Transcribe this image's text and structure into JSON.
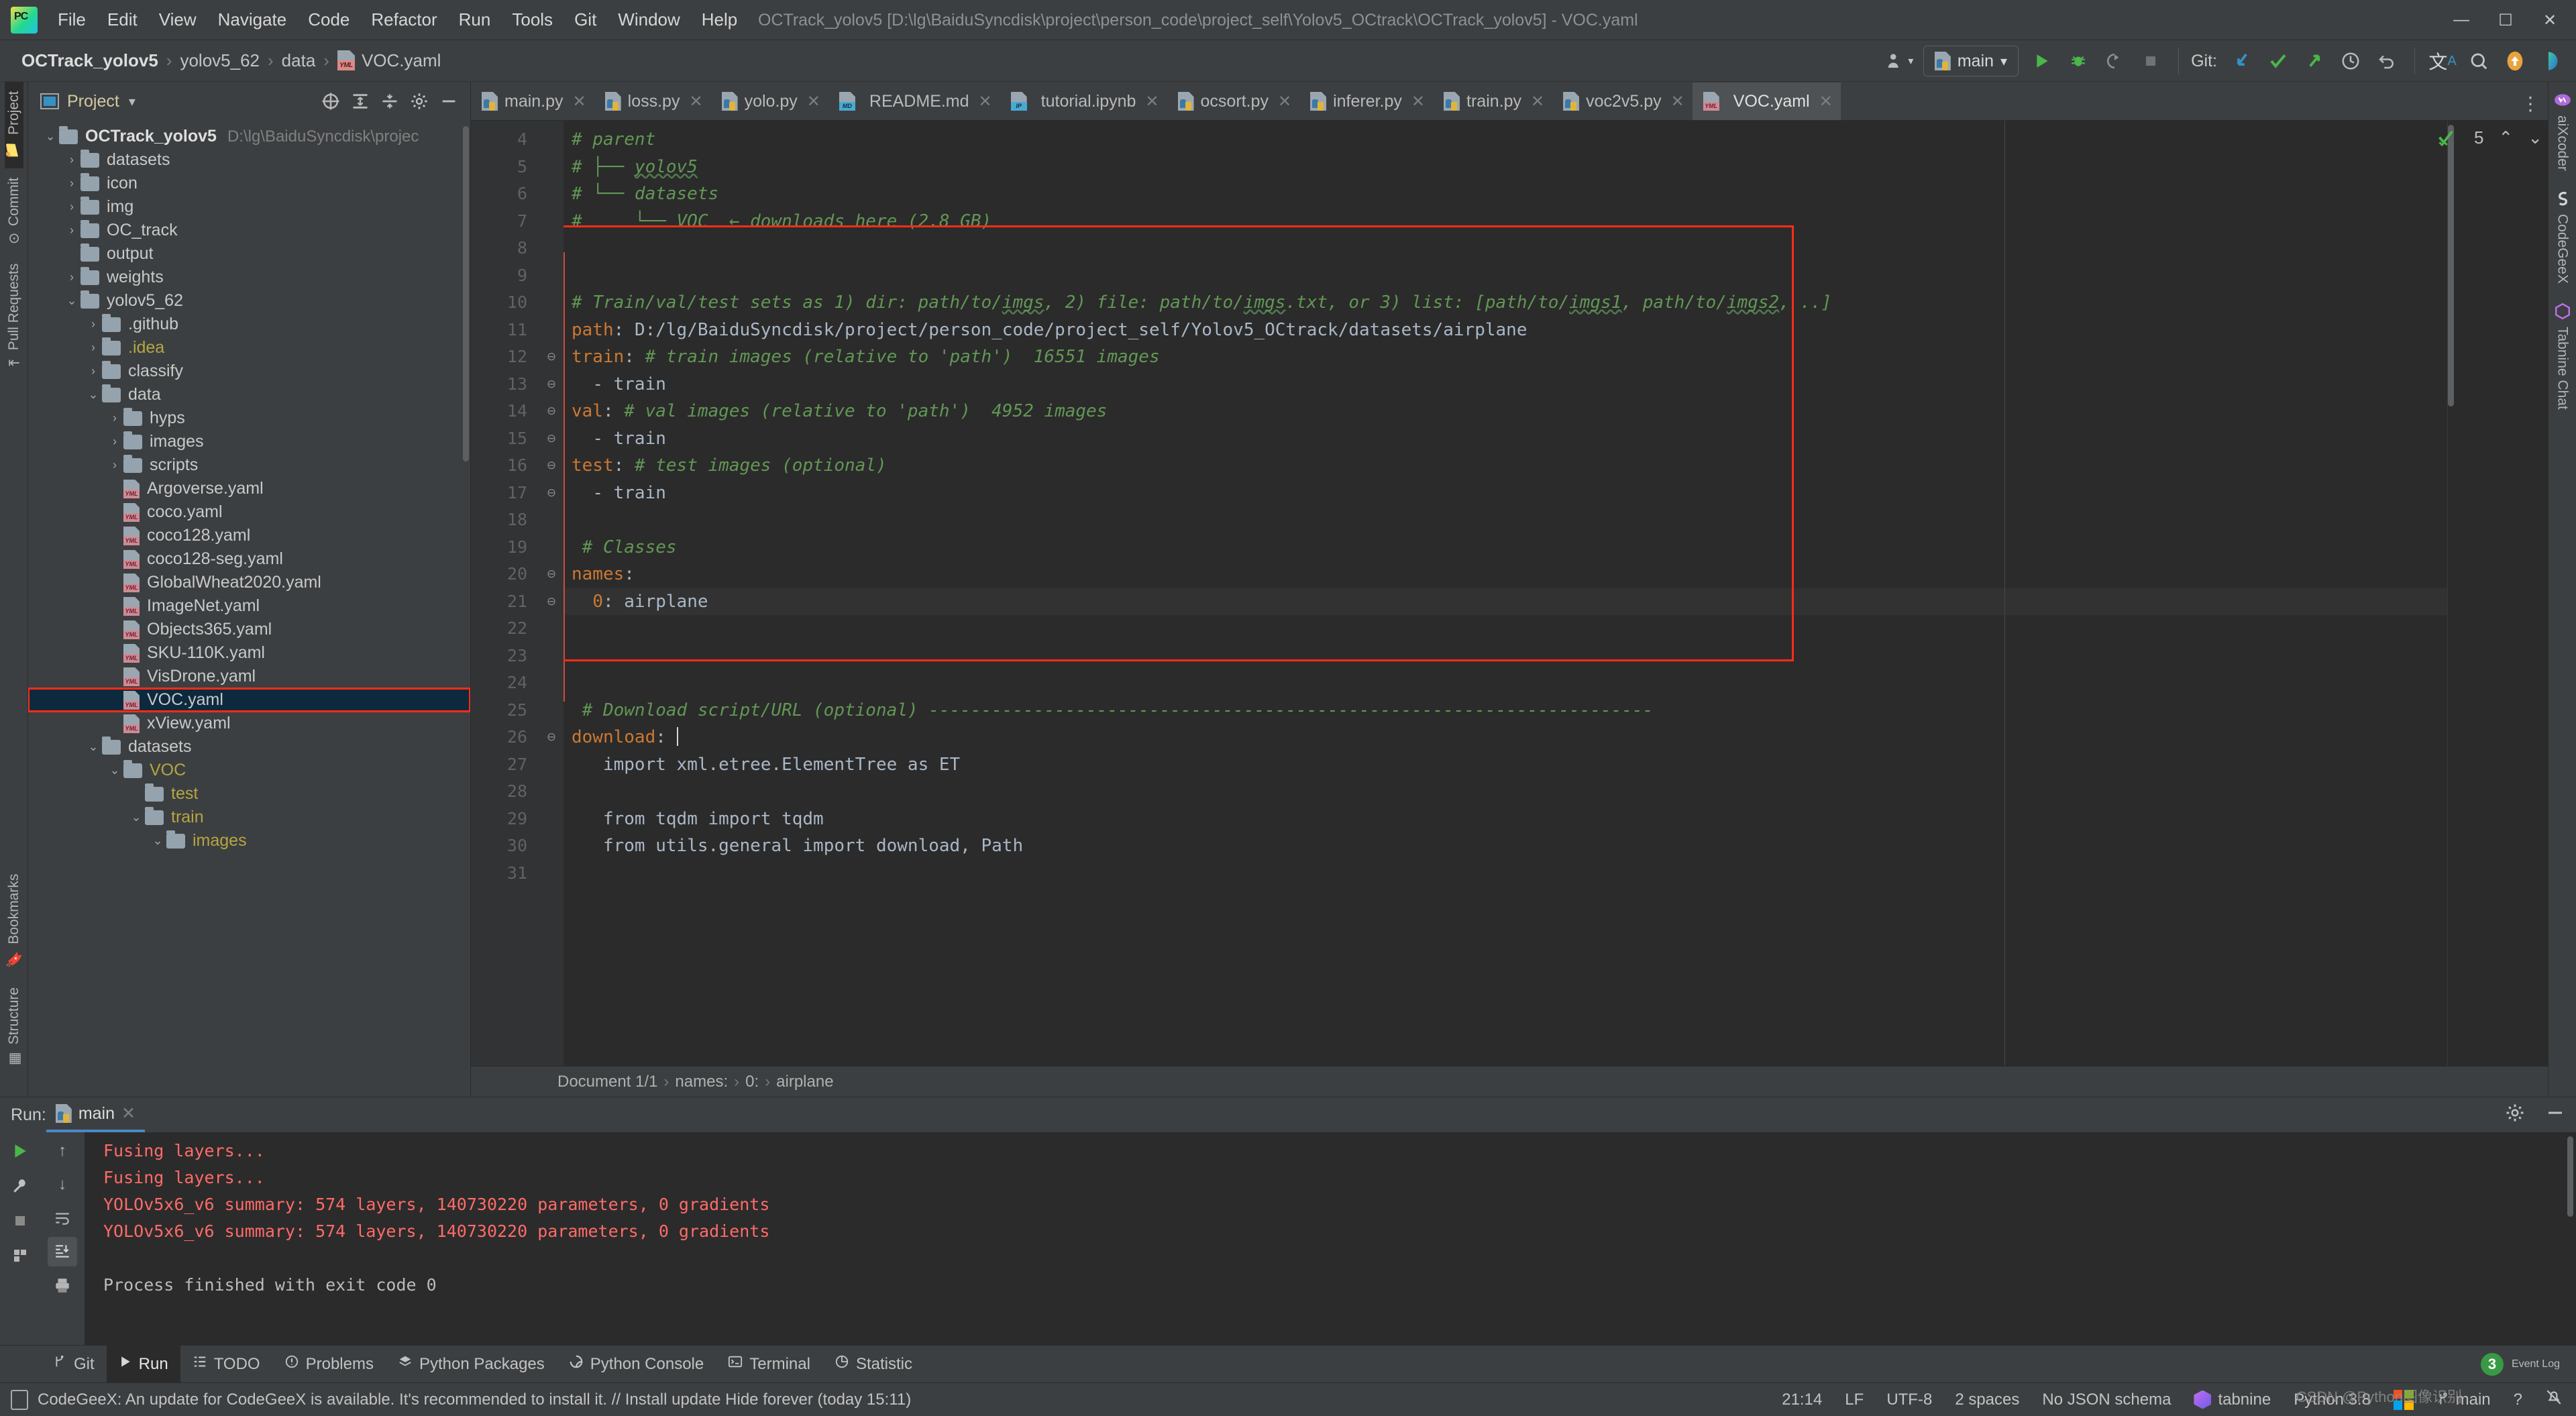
{
  "window": {
    "title": "OCTrack_yolov5 [D:\\lg\\BaiduSyncdisk\\project\\person_code\\project_self\\Yolov5_OCtrack\\OCTrack_yolov5] - VOC.yaml",
    "minimize": "—",
    "maximize": "☐",
    "close": "✕"
  },
  "menu": {
    "items": [
      "File",
      "Edit",
      "View",
      "Navigate",
      "Code",
      "Refactor",
      "Run",
      "Tools",
      "Git",
      "Window",
      "Help"
    ]
  },
  "breadcrumbs": {
    "items": [
      "OCTrack_yolov5",
      "yolov5_62",
      "data",
      "VOC.yaml"
    ],
    "separator": "›"
  },
  "toolbar": {
    "run_config": "main",
    "git_label": "Git:",
    "dropdown_caret": "▾"
  },
  "left_stripe": {
    "tabs": [
      "Project",
      "Commit",
      "Pull Requests"
    ],
    "bottom_tabs": [
      "Structure",
      "Bookmarks"
    ]
  },
  "right_stripe": {
    "tabs": [
      "aiXcoder",
      "CodeGeeX",
      "Tabnine Chat"
    ]
  },
  "project_panel": {
    "title": "Project",
    "caret": "▾",
    "tree": [
      {
        "depth": 0,
        "arrow": "⌄",
        "type": "folder",
        "label": "OCTrack_yolov5",
        "bold": true,
        "path": "D:\\lg\\BaiduSyncdisk\\projec"
      },
      {
        "depth": 1,
        "arrow": "›",
        "type": "folder",
        "label": "datasets"
      },
      {
        "depth": 1,
        "arrow": "›",
        "type": "folder",
        "label": "icon"
      },
      {
        "depth": 1,
        "arrow": "›",
        "type": "folder",
        "label": "img"
      },
      {
        "depth": 1,
        "arrow": "›",
        "type": "folder",
        "label": "OC_track"
      },
      {
        "depth": 1,
        "arrow": "",
        "type": "folder",
        "label": "output"
      },
      {
        "depth": 1,
        "arrow": "›",
        "type": "folder",
        "label": "weights"
      },
      {
        "depth": 1,
        "arrow": "⌄",
        "type": "folder",
        "label": "yolov5_62"
      },
      {
        "depth": 2,
        "arrow": "›",
        "type": "folder",
        "label": ".github"
      },
      {
        "depth": 2,
        "arrow": "›",
        "type": "folder",
        "label": ".idea",
        "color": "yellow"
      },
      {
        "depth": 2,
        "arrow": "›",
        "type": "folder",
        "label": "classify"
      },
      {
        "depth": 2,
        "arrow": "⌄",
        "type": "folder",
        "label": "data"
      },
      {
        "depth": 3,
        "arrow": "›",
        "type": "folder",
        "label": "hyps"
      },
      {
        "depth": 3,
        "arrow": "›",
        "type": "folder",
        "label": "images"
      },
      {
        "depth": 3,
        "arrow": "›",
        "type": "folder",
        "label": "scripts"
      },
      {
        "depth": 3,
        "arrow": "",
        "type": "yaml",
        "label": "Argoverse.yaml"
      },
      {
        "depth": 3,
        "arrow": "",
        "type": "yaml",
        "label": "coco.yaml"
      },
      {
        "depth": 3,
        "arrow": "",
        "type": "yaml",
        "label": "coco128.yaml"
      },
      {
        "depth": 3,
        "arrow": "",
        "type": "yaml",
        "label": "coco128-seg.yaml"
      },
      {
        "depth": 3,
        "arrow": "",
        "type": "yaml",
        "label": "GlobalWheat2020.yaml"
      },
      {
        "depth": 3,
        "arrow": "",
        "type": "yaml",
        "label": "ImageNet.yaml"
      },
      {
        "depth": 3,
        "arrow": "",
        "type": "yaml",
        "label": "Objects365.yaml"
      },
      {
        "depth": 3,
        "arrow": "",
        "type": "yaml",
        "label": "SKU-110K.yaml"
      },
      {
        "depth": 3,
        "arrow": "",
        "type": "yaml",
        "label": "VisDrone.yaml"
      },
      {
        "depth": 3,
        "arrow": "",
        "type": "yaml",
        "label": "VOC.yaml",
        "selected": true,
        "boxed": true
      },
      {
        "depth": 3,
        "arrow": "",
        "type": "yaml",
        "label": "xView.yaml"
      },
      {
        "depth": 2,
        "arrow": "⌄",
        "type": "folder",
        "label": "datasets"
      },
      {
        "depth": 3,
        "arrow": "⌄",
        "type": "folder",
        "label": "VOC",
        "color": "yellow"
      },
      {
        "depth": 4,
        "arrow": "",
        "type": "folder",
        "label": "test",
        "color": "yellow"
      },
      {
        "depth": 4,
        "arrow": "⌄",
        "type": "folder",
        "label": "train",
        "color": "yellow"
      },
      {
        "depth": 5,
        "arrow": "⌄",
        "type": "folder",
        "label": "images",
        "color": "yellow"
      }
    ]
  },
  "editor": {
    "tabs": [
      {
        "label": "main.py",
        "icon": "python-file-icon",
        "active": false
      },
      {
        "label": "loss.py",
        "icon": "python-file-icon",
        "active": false
      },
      {
        "label": "yolo.py",
        "icon": "python-file-icon",
        "active": false
      },
      {
        "label": "README.md",
        "icon": "markdown-file-icon",
        "active": false
      },
      {
        "label": "tutorial.ipynb",
        "icon": "notebook-file-icon",
        "active": false
      },
      {
        "label": "ocsort.py",
        "icon": "python-file-icon",
        "active": false
      },
      {
        "label": "inferer.py",
        "icon": "python-file-icon",
        "active": false
      },
      {
        "label": "train.py",
        "icon": "python-file-icon",
        "active": false
      },
      {
        "label": "voc2v5.py",
        "icon": "python-file-icon",
        "active": false
      },
      {
        "label": "VOC.yaml",
        "icon": "yaml-file-icon",
        "active": true
      }
    ],
    "tab_close": "✕",
    "inspection_count": "5",
    "inspection_up": "⌃",
    "inspection_down": "⌄",
    "first_line_number": 4,
    "lines": [
      {
        "n": 4,
        "fold": "",
        "html": "<span class=\"cm\"># parent</span>"
      },
      {
        "n": 5,
        "fold": "",
        "html": "<span class=\"cm\"># ├── <span class=\"squig\">yolov5</span></span>"
      },
      {
        "n": 6,
        "fold": "",
        "html": "<span class=\"cm\"># └── datasets</span>"
      },
      {
        "n": 7,
        "fold": "",
        "html": "<span class=\"cm\">#     └── VOC  ← downloads here (2.8 GB)</span>"
      },
      {
        "n": 8,
        "fold": "",
        "html": ""
      },
      {
        "n": 9,
        "fold": "",
        "html": ""
      },
      {
        "n": 10,
        "fold": "",
        "html": "<span class=\"cm\"># Train/val/test sets as 1) dir: path/to/<span class=\"squig\">imgs</span>, 2) file: path/to/<span class=\"squig\">imgs</span>.txt, or 3) list: [path/to/<span class=\"squig\">imgs1</span>, path/to/<span class=\"squig\">imgs2</span>, ..]</span>"
      },
      {
        "n": 11,
        "fold": "",
        "html": "<span class=\"key\">path</span>: <span class=\"val\">D:/lg/BaiduSyncdisk/project/person_code/project_self/Yolov5_OCtrack/datasets/airplane</span>"
      },
      {
        "n": 12,
        "fold": "⊖",
        "html": "<span class=\"key\">train</span>: <span class=\"cm\"># train images (relative to 'path')  16551 images</span>"
      },
      {
        "n": 13,
        "fold": "⊖",
        "html": "  <span class=\"val\">- train</span>"
      },
      {
        "n": 14,
        "fold": "⊖",
        "html": "<span class=\"key\">val</span>: <span class=\"cm\"># val images (relative to 'path')  4952 images</span>"
      },
      {
        "n": 15,
        "fold": "⊖",
        "html": "  <span class=\"val\">- train</span>"
      },
      {
        "n": 16,
        "fold": "⊖",
        "html": "<span class=\"key\">test</span>: <span class=\"cm\"># test images (optional)</span>"
      },
      {
        "n": 17,
        "fold": "⊖",
        "html": "  <span class=\"val\">- train</span>"
      },
      {
        "n": 18,
        "fold": "",
        "html": ""
      },
      {
        "n": 19,
        "fold": "",
        "html": " <span class=\"cm\"># Classes</span>"
      },
      {
        "n": 20,
        "fold": "⊖",
        "html": "<span class=\"key\">names</span>:"
      },
      {
        "n": 21,
        "fold": "⊖",
        "html": "  <span class=\"key\">0</span>: <span class=\"val\">airplane</span>",
        "highlight": true
      },
      {
        "n": 22,
        "fold": "",
        "html": ""
      },
      {
        "n": 23,
        "fold": "",
        "html": ""
      },
      {
        "n": 24,
        "fold": "",
        "html": ""
      },
      {
        "n": 25,
        "fold": "",
        "html": " <span class=\"cm\"># Download script/URL (optional) ---------------------------------------------------------------------</span>"
      },
      {
        "n": 26,
        "fold": "⊖",
        "html": "<span class=\"key\">download</span>: <span class=\"caret\"></span>"
      },
      {
        "n": 27,
        "fold": "",
        "html": "   <span class=\"val\">import xml.etree.ElementTree as ET</span>"
      },
      {
        "n": 28,
        "fold": "",
        "html": ""
      },
      {
        "n": 29,
        "fold": "",
        "html": "   <span class=\"val\">from tqdm import tqdm</span>"
      },
      {
        "n": 30,
        "fold": "",
        "html": "   <span class=\"val\">from utils.general import download, Path</span>"
      },
      {
        "n": 31,
        "fold": "",
        "html": ""
      }
    ],
    "status_breadcrumb": [
      "Document 1/1",
      "names:",
      "0:",
      "airplane"
    ],
    "status_breadcrumb_sep": "›"
  },
  "run_panel": {
    "title": "Run:",
    "tab_label": "main",
    "tab_close": "✕",
    "output": [
      {
        "text": "Fusing layers...",
        "error": true
      },
      {
        "text": "Fusing layers...",
        "error": true
      },
      {
        "text": "YOLOv5x6_v6 summary: 574 layers, 140730220 parameters, 0 gradients",
        "error": true
      },
      {
        "text": "YOLOv5x6_v6 summary: 574 layers, 140730220 parameters, 0 gradients",
        "error": true
      },
      {
        "text": "",
        "error": false
      },
      {
        "text": "Process finished with exit code 0",
        "error": false
      }
    ]
  },
  "tool_window_bar": {
    "items": [
      {
        "label": "Git",
        "icon": "git-branch-icon",
        "selected": false
      },
      {
        "label": "Run",
        "icon": "run-play-icon",
        "selected": true
      },
      {
        "label": "TODO",
        "icon": "todo-list-icon",
        "selected": false
      },
      {
        "label": "Problems",
        "icon": "problems-icon",
        "selected": false
      },
      {
        "label": "Python Packages",
        "icon": "packages-icon",
        "selected": false
      },
      {
        "label": "Python Console",
        "icon": "python-console-icon",
        "selected": false
      },
      {
        "label": "Terminal",
        "icon": "terminal-icon",
        "selected": false
      },
      {
        "label": "Statistic",
        "icon": "statistic-icon",
        "selected": false
      }
    ],
    "event_log": "Event Log",
    "event_log_count": "3"
  },
  "status_bar": {
    "notification": "CodeGeeX: An update for CodeGeeX is available. It's recommended to install it. // Install update   Hide forever (today 15:11)",
    "caret_position": "21:14",
    "line_separator": "LF",
    "encoding": "UTF-8",
    "indent": "2 spaces",
    "schema": "No JSON schema",
    "tabnine": "tabnine",
    "interpreter": "Python 3.8",
    "branch": "main",
    "watermark": "CSDN @Python图像识别"
  },
  "colors": {
    "bg": "#3c3f41",
    "editor_bg": "#2b2b2b",
    "accent_blue": "#4a88c7",
    "comment_green": "#629755",
    "key_orange": "#cc7832",
    "error_red": "#ff6b68",
    "highlight_box": "#ff2d16",
    "selection": "#0d293e"
  }
}
